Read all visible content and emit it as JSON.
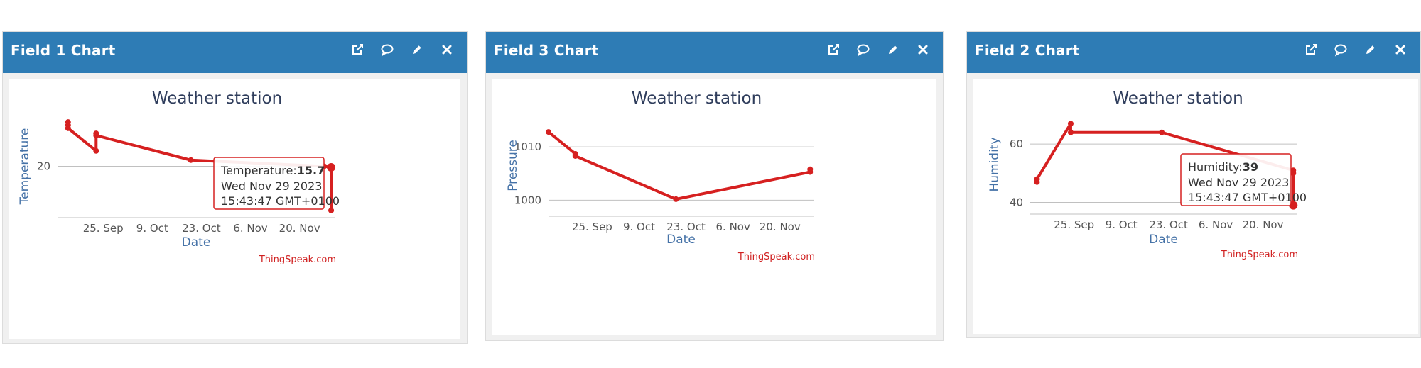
{
  "panels": [
    {
      "id": "field1",
      "header_title": "Field 1 Chart",
      "icons": [
        "external-link-icon",
        "comment-icon",
        "edit-icon",
        "close-icon"
      ],
      "credits": "ThingSpeak.com",
      "tooltip": {
        "label": "Temperature:",
        "value": "15.7",
        "date": "Wed Nov 29 2023",
        "time": "15:43:47 GMT+0100"
      }
    },
    {
      "id": "field3",
      "header_title": "Field 3 Chart",
      "icons": [
        "external-link-icon",
        "comment-icon",
        "edit-icon",
        "close-icon"
      ],
      "credits": "ThingSpeak.com"
    },
    {
      "id": "field2",
      "header_title": "Field 2 Chart",
      "icons": [
        "external-link-icon",
        "comment-icon",
        "edit-icon",
        "close-icon"
      ],
      "credits": "ThingSpeak.com",
      "tooltip": {
        "label": "Humidity:",
        "value": "39",
        "date": "Wed Nov 29 2023",
        "time": "15:43:47 GMT+0100"
      }
    }
  ],
  "colors": {
    "header": "#2e7cb5",
    "series": "#d62020",
    "grid": "#c0c0c0",
    "axis_title": "#4572a7"
  },
  "chart_data": [
    {
      "type": "line",
      "title": "Weather station",
      "xlabel": "Date",
      "ylabel": "Temperature",
      "x_ticks": [
        "25. Sep",
        "9. Oct",
        "23. Oct",
        "6. Nov",
        "20. Nov"
      ],
      "y_ticks": [
        20
      ],
      "ylim": [
        15,
        25
      ],
      "grid": true,
      "series": [
        {
          "x": [
            "2023-09-15",
            "2023-09-15",
            "2023-09-15",
            "2023-09-23",
            "2023-09-23",
            "2023-09-23",
            "2023-10-20",
            "2023-11-27",
            "2023-11-29",
            "2023-11-29"
          ],
          "y": [
            24.0,
            24.3,
            23.7,
            21.5,
            23.2,
            23.0,
            20.6,
            20.0,
            19.9,
            15.7
          ]
        }
      ]
    },
    {
      "type": "line",
      "title": "Weather station",
      "xlabel": "Date",
      "ylabel": "Pressure",
      "x_ticks": [
        "25. Sep",
        "9. Oct",
        "23. Oct",
        "6. Nov",
        "20. Nov"
      ],
      "y_ticks": [
        1000,
        1010
      ],
      "ylim": [
        997,
        1016
      ],
      "grid": true,
      "series": [
        {
          "x": [
            "2023-09-12",
            "2023-09-20",
            "2023-09-20",
            "2023-10-20",
            "2023-11-29",
            "2023-11-29"
          ],
          "y": [
            1012.8,
            1008.7,
            1008.3,
            1000.2,
            1005.3,
            1005.8
          ]
        }
      ]
    },
    {
      "type": "line",
      "title": "Weather station",
      "xlabel": "Date",
      "ylabel": "Humidity",
      "x_ticks": [
        "25. Sep",
        "9. Oct",
        "23. Oct",
        "6. Nov",
        "20. Nov"
      ],
      "y_ticks": [
        40,
        60
      ],
      "ylim": [
        36,
        70
      ],
      "grid": true,
      "series": [
        {
          "x": [
            "2023-09-14",
            "2023-09-14",
            "2023-09-24",
            "2023-09-24",
            "2023-10-21",
            "2023-11-29",
            "2023-11-29",
            "2023-11-29"
          ],
          "y": [
            47,
            48,
            67,
            64,
            64,
            51,
            50,
            39
          ]
        }
      ]
    }
  ]
}
